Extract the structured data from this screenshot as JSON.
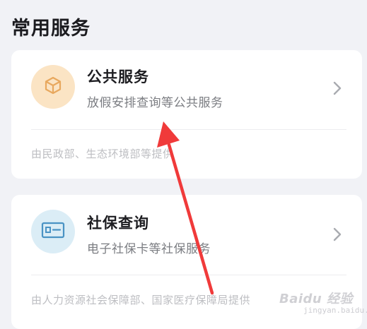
{
  "section": {
    "title": "常用服务"
  },
  "cards": [
    {
      "icon": "box-icon",
      "icon_bg": "#fbe4c4",
      "icon_color": "#e8a85e",
      "title": "公共服务",
      "subtitle": "放假安排查询等公共服务",
      "provider": "由民政部、生态环境部等提供"
    },
    {
      "icon": "id-card-icon",
      "icon_bg": "#dbedf6",
      "icon_color": "#4a93c4",
      "title": "社保查询",
      "subtitle": "电子社保卡等社保服务",
      "provider": "由人力资源社会保障部、国家医疗保障局提供"
    }
  ],
  "annotation": {
    "arrow_color": "#f03a3a"
  },
  "watermark": {
    "brand": "Baidu 经验",
    "url": "jingyan.baidu.com"
  }
}
